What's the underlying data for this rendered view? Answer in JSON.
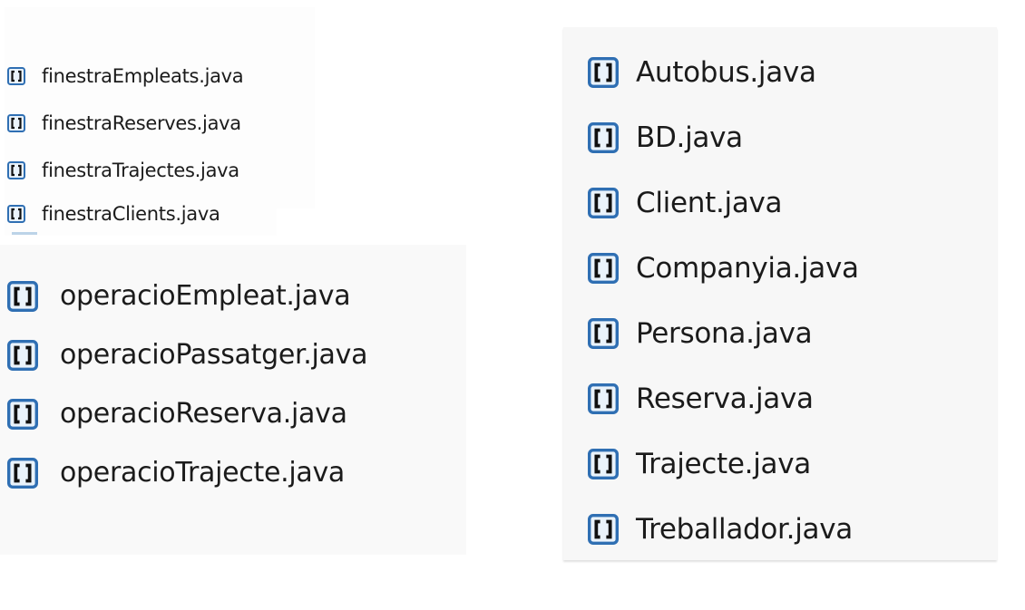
{
  "colors": {
    "icon_border": "#2f6fb3",
    "icon_fill": "#eaf3fb",
    "icon_glyph": "#111111",
    "text": "#1b1b1b"
  },
  "icon_name": "java-file-icon",
  "groups": {
    "finestra": {
      "files": [
        {
          "name": "finestraEmpleats.java"
        },
        {
          "name": "finestraReserves.java"
        },
        {
          "name": "finestraTrajectes.java"
        },
        {
          "name": "finestraClients.java"
        }
      ]
    },
    "operacio": {
      "files": [
        {
          "name": "operacioEmpleat.java"
        },
        {
          "name": "operacioPassatger.java"
        },
        {
          "name": "operacioReserva.java"
        },
        {
          "name": "operacioTrajecte.java"
        }
      ]
    },
    "models": {
      "files": [
        {
          "name": "Autobus.java"
        },
        {
          "name": "BD.java"
        },
        {
          "name": "Client.java"
        },
        {
          "name": "Companyia.java"
        },
        {
          "name": "Persona.java"
        },
        {
          "name": "Reserva.java"
        },
        {
          "name": "Trajecte.java"
        },
        {
          "name": "Treballador.java"
        }
      ]
    }
  }
}
